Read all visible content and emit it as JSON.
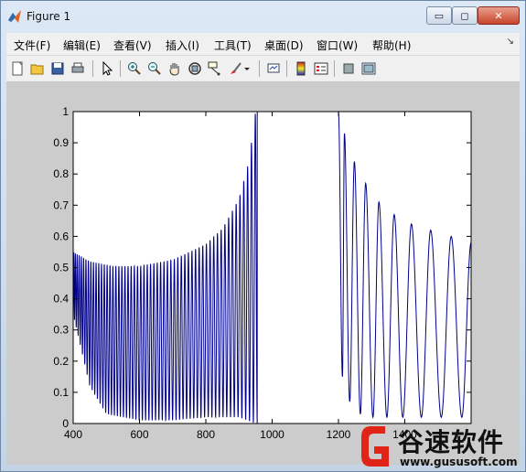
{
  "window": {
    "title": "Figure 1",
    "controls": {
      "minimize": "▭",
      "maximize": "◻",
      "close": "✕"
    }
  },
  "menubar": {
    "items": [
      {
        "label": "文件(F)"
      },
      {
        "label": "编辑(E)"
      },
      {
        "label": "查看(V)"
      },
      {
        "label": "插入(I)"
      },
      {
        "label": "工具(T)"
      },
      {
        "label": "桌面(D)"
      },
      {
        "label": "窗口(W)"
      },
      {
        "label": "帮助(H)"
      }
    ],
    "dock_arrow": "↘"
  },
  "toolbar": {
    "icons": [
      "new-figure-icon",
      "open-file-icon",
      "save-icon",
      "print-icon",
      "edit-plot-arrow-icon",
      "zoom-in-icon",
      "zoom-out-icon",
      "pan-hand-icon",
      "rotate-3d-icon",
      "data-cursor-icon",
      "brush-icon",
      "brush-dropdown-icon",
      "link-plot-icon",
      "colorbar-icon",
      "legend-icon",
      "hide-plot-tools-icon",
      "show-plot-tools-icon"
    ]
  },
  "colors": {
    "line": "#00008b",
    "figure_background": "#cccccc",
    "axes_background": "#ffffff",
    "watermark_red": "#e02418"
  },
  "chart_data": {
    "type": "line",
    "title": "",
    "xlabel": "",
    "ylabel": "",
    "xlim": [
      400,
      1600
    ],
    "ylim": [
      0,
      1
    ],
    "x_ticks": [
      400,
      600,
      800,
      1000,
      1200,
      1400
    ],
    "y_ticks": [
      0,
      0.1,
      0.2,
      0.3,
      0.4,
      0.5,
      0.6,
      0.7,
      0.8,
      0.9,
      1
    ],
    "x_tick_labels": [
      "400",
      "600",
      "800",
      "1000",
      "1200",
      "1400"
    ],
    "y_tick_labels": [
      "0",
      "0.1",
      "0.2",
      "0.3",
      "0.4",
      "0.5",
      "0.6",
      "0.7",
      "0.8",
      "0.9",
      "1"
    ],
    "grid": false,
    "legend": null,
    "series": [
      {
        "description": "oscillating reflectance curve",
        "segments": [
          {
            "x_start": 400,
            "x_end": 955,
            "upper_envelope": [
              [
                400,
                0.55
              ],
              [
                450,
                0.52
              ],
              [
                520,
                0.505
              ],
              [
                600,
                0.505
              ],
              [
                700,
                0.525
              ],
              [
                800,
                0.575
              ],
              [
                850,
                0.625
              ],
              [
                900,
                0.72
              ],
              [
                930,
                0.84
              ],
              [
                950,
                1.0
              ]
            ],
            "lower_envelope": [
              [
                400,
                0.35
              ],
              [
                450,
                0.12
              ],
              [
                500,
                0.03
              ],
              [
                600,
                0.01
              ],
              [
                700,
                0.01
              ],
              [
                800,
                0.02
              ],
              [
                900,
                0.02
              ],
              [
                950,
                0.0
              ]
            ],
            "oscillation_count": 58
          },
          {
            "x_start": 955,
            "x_end": 1200,
            "value": 1.0
          },
          {
            "x_start": 1200,
            "x_end": 1600,
            "peaks": [
              [
                1200,
                1.0
              ],
              [
                1218,
                0.93
              ],
              [
                1248,
                0.84
              ],
              [
                1282,
                0.77
              ],
              [
                1322,
                0.71
              ],
              [
                1368,
                0.67
              ],
              [
                1420,
                0.64
              ],
              [
                1478,
                0.62
              ],
              [
                1540,
                0.6
              ],
              [
                1600,
                0.58
              ]
            ],
            "valleys": [
              [
                1212,
                0.15
              ],
              [
                1234,
                0.07
              ],
              [
                1266,
                0.03
              ],
              [
                1304,
                0.02
              ],
              [
                1346,
                0.02
              ],
              [
                1394,
                0.02
              ],
              [
                1450,
                0.02
              ],
              [
                1510,
                0.02
              ],
              [
                1572,
                0.02
              ]
            ]
          }
        ]
      }
    ]
  },
  "watermark": {
    "brand": "谷速软件",
    "url": "www.gususoft.com"
  }
}
